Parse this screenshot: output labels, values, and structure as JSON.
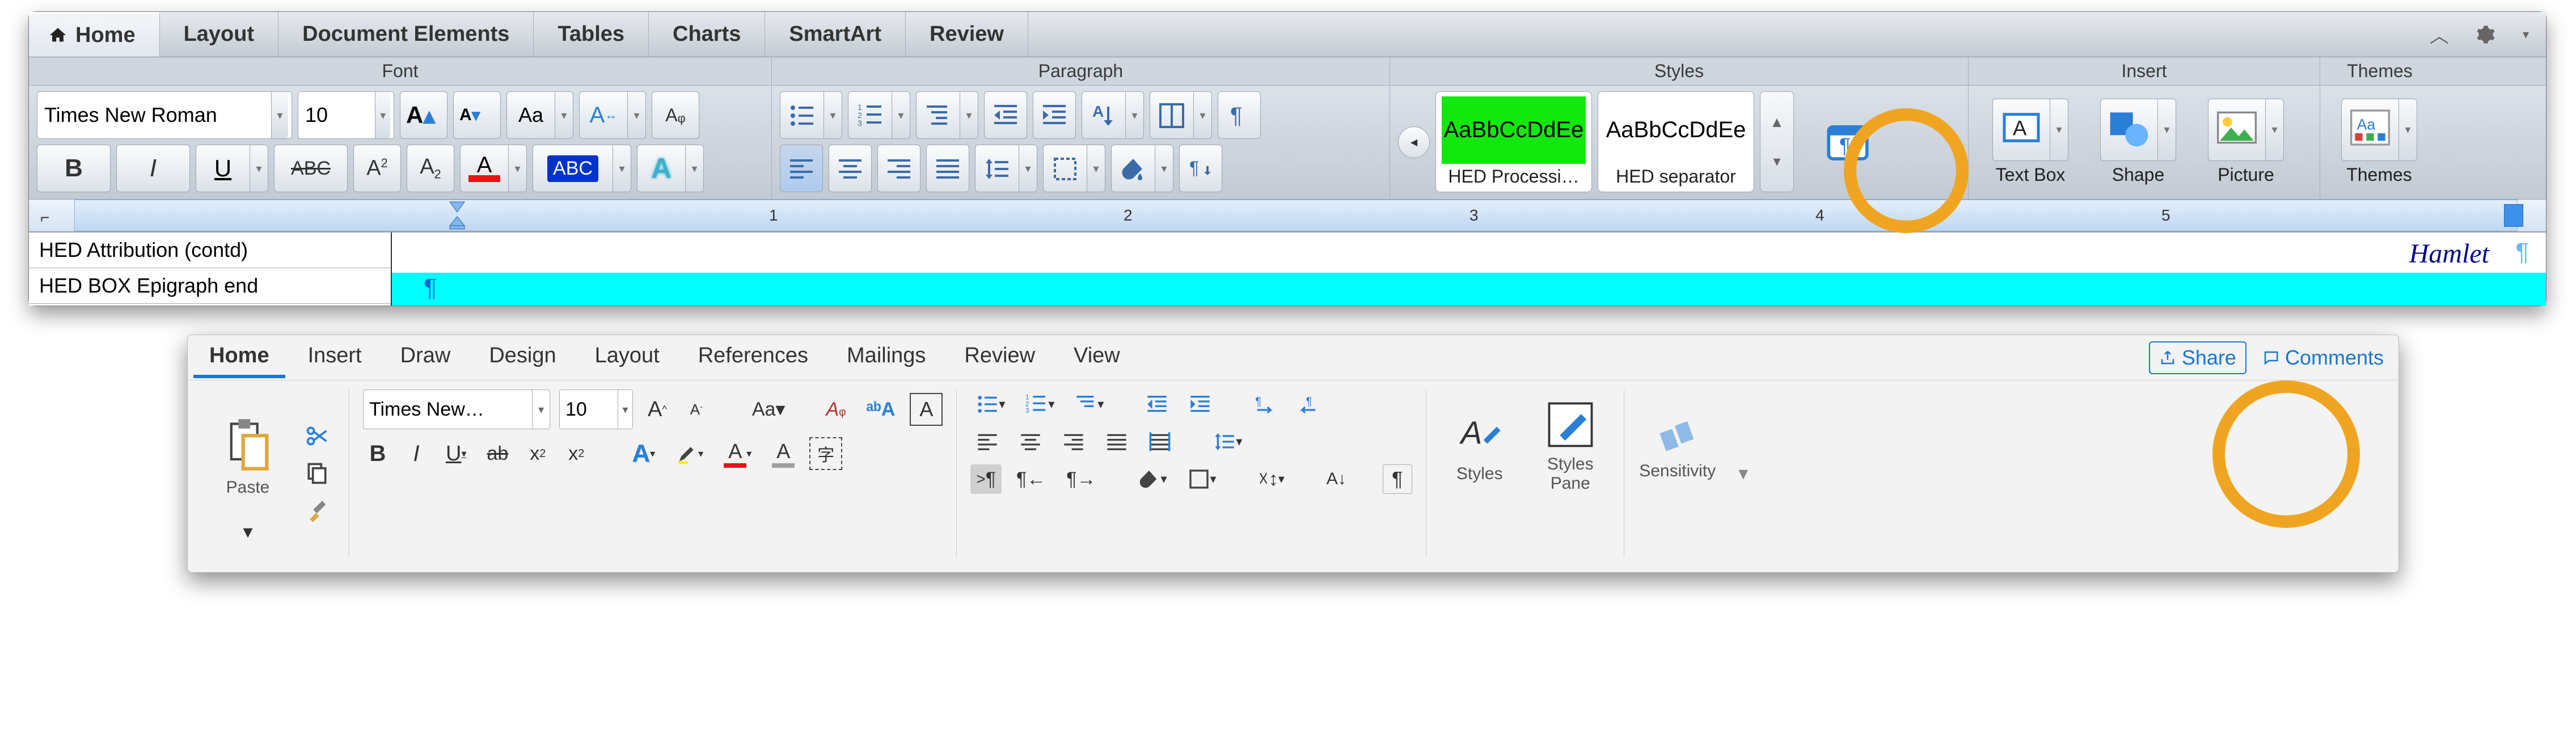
{
  "top": {
    "tabs": [
      "Home",
      "Layout",
      "Document Elements",
      "Tables",
      "Charts",
      "SmartArt",
      "Review"
    ],
    "active_tab": 0,
    "group_labels": [
      "Font",
      "Paragraph",
      "Styles",
      "Insert",
      "Themes"
    ],
    "font": {
      "family": "Times New Roman",
      "size": "10",
      "btns": {
        "bold": "B",
        "italic": "I",
        "underline": "U",
        "strike": "ABC",
        "super": "A",
        "super_exp": "2",
        "sub": "A",
        "sub_exp": "2",
        "grow": "A",
        "shrink": "A",
        "case": "Aa",
        "char_scale": "A",
        "clear": "Aᵩ",
        "font_color": "A",
        "highlight": "ABC",
        "effects": "A"
      }
    },
    "styles": {
      "cards": [
        {
          "preview": "AaBbCcDdEe",
          "label": "HED Processi…"
        },
        {
          "preview": "AaBbCcDdEe",
          "label": "HED separator"
        }
      ]
    },
    "insert": {
      "textbox": "Text Box",
      "shape": "Shape",
      "picture": "Picture"
    },
    "themes": "Themes",
    "ruler_nums": {
      "1": "1",
      "2": "2",
      "3": "3",
      "4": "4",
      "5": "5"
    },
    "style_panel": [
      "HED Attribution (contd)",
      "HED BOX Epigraph end"
    ],
    "heading": "Hamlet",
    "pilcrow": "¶"
  },
  "bottom": {
    "tabs": [
      "Home",
      "Insert",
      "Draw",
      "Design",
      "Layout",
      "References",
      "Mailings",
      "Review",
      "View"
    ],
    "active_tab": 0,
    "share": "Share",
    "comments": "Comments",
    "paste": "Paste",
    "font_family": "Times New…",
    "font_size": "10",
    "btns": {
      "grow": "A",
      "shrink": "A",
      "case": "Aa",
      "bold": "B",
      "italic": "I",
      "underline": "U",
      "strike": "ab",
      "sub": "x",
      "sub_exp": "2",
      "sup": "x",
      "sup_exp": "2",
      "texteffects": "A",
      "highlight": "ℓ",
      "font_color": "A",
      "clear": "Aᵩ",
      "bord_a": "A",
      "showmarks": "¶",
      "sort": "A"
    },
    "big": {
      "styles": "Styles",
      "stylespane_l1": "Styles",
      "stylespane_l2": "Pane",
      "sensitivity": "Sensitivity"
    }
  }
}
